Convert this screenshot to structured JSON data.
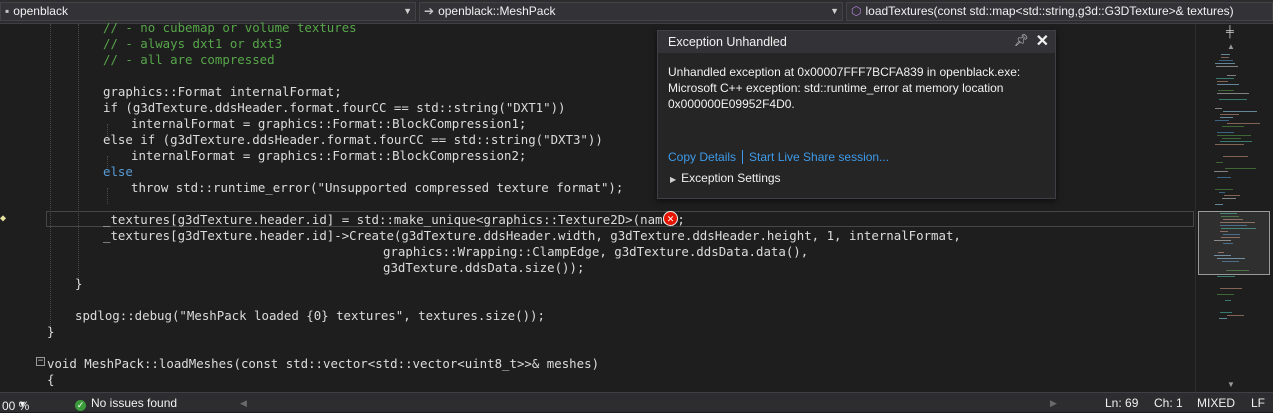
{
  "nav": {
    "project": "openblack",
    "scope": "openblack::MeshPack",
    "member": "loadTextures(const std::map<std::string,g3d::G3DTexture>& textures)"
  },
  "popup": {
    "title": "Exception Unhandled",
    "message_line1": "Unhandled exception at 0x00007FFF7BCFA839 in openblack.exe:",
    "message_line2": "Microsoft C++ exception: std::runtime_error at memory location",
    "message_line3": "0x000000E09952F4D0.",
    "copy_details": "Copy Details",
    "live_share": "Start Live Share session...",
    "exception_settings": "Exception Settings"
  },
  "code": [
    "// - no cubemap or volume textures",
    "// - always dxt1 or dxt3",
    "// - all are compressed",
    "graphics::Format internalFormat;",
    "if (g3dTexture.ddsHeader.format.fourCC == std::string(\"DXT1\"))",
    "internalFormat = graphics::Format::BlockCompression1;",
    "else if (g3dTexture.ddsHeader.format.fourCC == std::string(\"DXT3\"))",
    "internalFormat = graphics::Format::BlockCompression2;",
    "else",
    "throw std::runtime_error(\"Unsupported compressed texture format\");",
    "_textures[g3dTexture.header.id] = std::make_unique<graphics::Texture2D>(name);",
    "_textures[g3dTexture.header.id]->Create(g3dTexture.ddsHeader.width, g3dTexture.ddsHeader.height, 1, internalFormat,",
    "graphics::Wrapping::ClampEdge, g3dTexture.ddsData.data(),",
    "g3dTexture.ddsData.size());",
    "}",
    "spdlog::debug(\"MeshPack loaded {0} textures\", textures.size());",
    "}",
    "void MeshPack::loadMeshes(const std::vector<std::vector<uint8_t>>& meshes)",
    "{"
  ],
  "status": {
    "zoom": "00 %",
    "issues": "No issues found",
    "line": "Ln: 69",
    "col": "Ch: 1",
    "mode": "MIXED",
    "eol": "LF"
  },
  "colors": {
    "background": "#1e1e1e",
    "comment": "#57a64a",
    "type": "#4ec9b0",
    "keyword": "#569cd6",
    "string": "#d69d85",
    "link": "#3e9ae8",
    "error": "#e51400"
  }
}
